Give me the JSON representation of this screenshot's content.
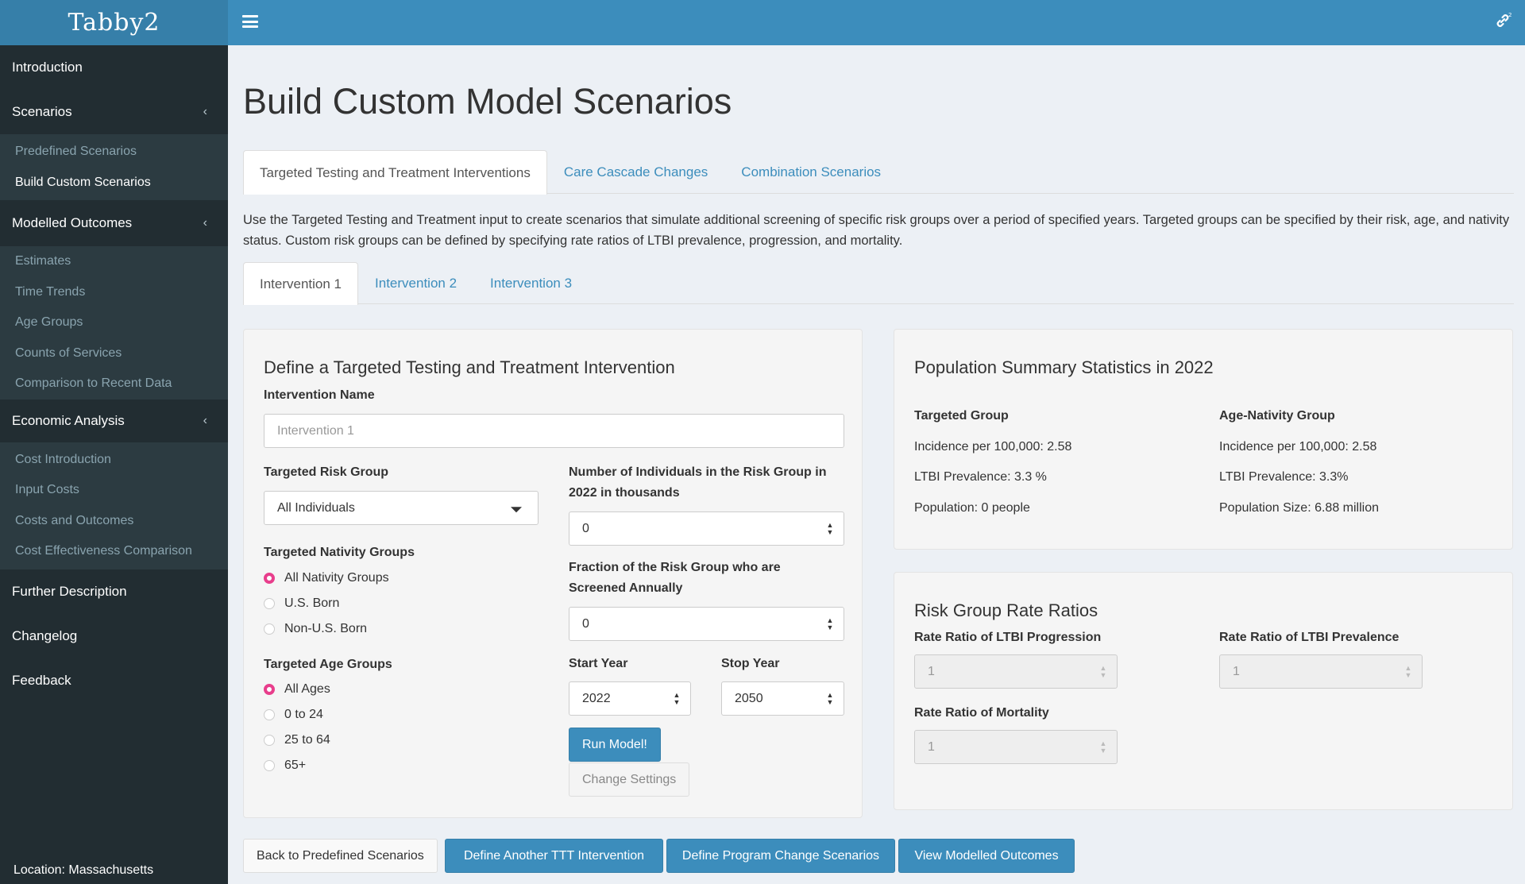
{
  "app": {
    "logo": "Tabby2",
    "location": "Location: Massachusetts"
  },
  "sidebar": {
    "items": [
      {
        "label": "Introduction"
      },
      {
        "label": "Scenarios",
        "sub": [
          "Predefined Scenarios",
          "Build Custom Scenarios"
        ]
      },
      {
        "label": "Modelled Outcomes",
        "sub": [
          "Estimates",
          "Time Trends",
          "Age Groups",
          "Counts of Services",
          "Comparison to Recent Data"
        ]
      },
      {
        "label": "Economic Analysis",
        "sub": [
          "Cost Introduction",
          "Input Costs",
          "Costs and Outcomes",
          "Cost Effectiveness Comparison"
        ]
      },
      {
        "label": "Further Description"
      },
      {
        "label": "Changelog"
      },
      {
        "label": "Feedback"
      }
    ],
    "active_sub": "Build Custom Scenarios",
    "chevron": "‹"
  },
  "page": {
    "title": "Build Custom Model Scenarios",
    "tabs": [
      "Targeted Testing and Treatment Interventions",
      "Care Cascade Changes",
      "Combination Scenarios"
    ],
    "description": "Use the Targeted Testing and Treatment input to create scenarios that simulate additional screening of specific risk groups over a period of specified years. Targeted groups can be specified by their risk, age, and nativity status. Custom risk groups can be defined by specifying rate ratios of LTBI prevalence, progression, and mortality.",
    "intervention_tabs": [
      "Intervention 1",
      "Intervention 2",
      "Intervention 3"
    ]
  },
  "form": {
    "title": "Define a Targeted Testing and Treatment Intervention",
    "name_label": "Intervention Name",
    "name_placeholder": "Intervention 1",
    "risk_label": "Targeted Risk Group",
    "risk_value": "All Individuals",
    "count_label_1": "Number of Individuals in the Risk Group in",
    "count_label_2": "2022 in thousands",
    "count_value": "0",
    "nativity_label": "Targeted Nativity Groups",
    "nativity_options": [
      "All Nativity Groups",
      "U.S. Born",
      "Non-U.S. Born"
    ],
    "fraction_label_1": "Fraction of the Risk Group who are",
    "fraction_label_2": "Screened Annually",
    "fraction_value": "0",
    "age_label": "Targeted Age Groups",
    "age_options": [
      "All Ages",
      "0 to 24",
      "25 to 64",
      "65+"
    ],
    "start_label": "Start Year",
    "start_value": "2022",
    "stop_label": "Stop Year",
    "stop_value": "2050",
    "run_button": "Run Model!",
    "change_button": "Change Settings"
  },
  "population": {
    "title": "Population Summary Statistics in 2022",
    "targeted_heading": "Targeted Group",
    "targeted": [
      "Incidence per 100,000: 2.58",
      "LTBI Prevalence: 3.3 %",
      "Population: 0 people"
    ],
    "age_heading": "Age-Nativity Group",
    "age": [
      "Incidence per 100,000: 2.58",
      "LTBI Prevalence: 3.3%",
      "Population Size: 6.88 million"
    ]
  },
  "rate_ratios": {
    "title": "Risk Group Rate Ratios",
    "progression_label": "Rate Ratio of LTBI Progression",
    "progression_value": "1",
    "prevalence_label": "Rate Ratio of LTBI Prevalence",
    "prevalence_value": "1",
    "mortality_label": "Rate Ratio of Mortality",
    "mortality_value": "1"
  },
  "footer_buttons": [
    "Back to Predefined Scenarios",
    "Define Another TTT Intervention",
    "Define Program Change Scenarios",
    "View Modelled Outcomes"
  ],
  "colors": {
    "header": "#3c8dbc",
    "sidebar": "#222d32",
    "radio_checked": "#e83e8c"
  }
}
